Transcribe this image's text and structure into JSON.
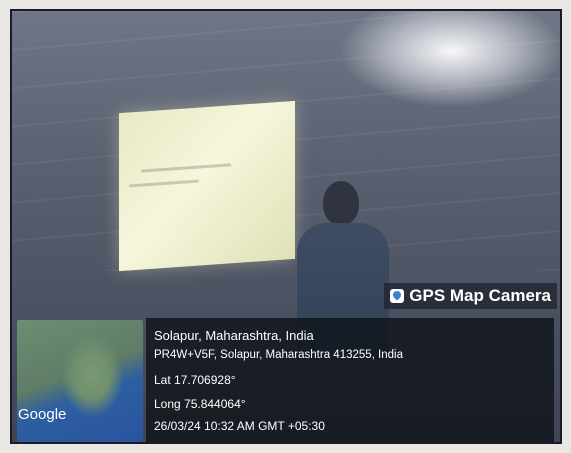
{
  "overlay": {
    "app_label": "GPS Map Camera",
    "app_icon": "map-pin-icon",
    "map_brand": "Google"
  },
  "location": {
    "place": "Solapur, Maharashtra, India",
    "address": "PR4W+V5F, Solapur, Maharashtra 413255, India",
    "lat": "Lat 17.706928°",
    "long": "Long 75.844064°",
    "timestamp": "26/03/24 10:32 AM GMT +05:30"
  }
}
